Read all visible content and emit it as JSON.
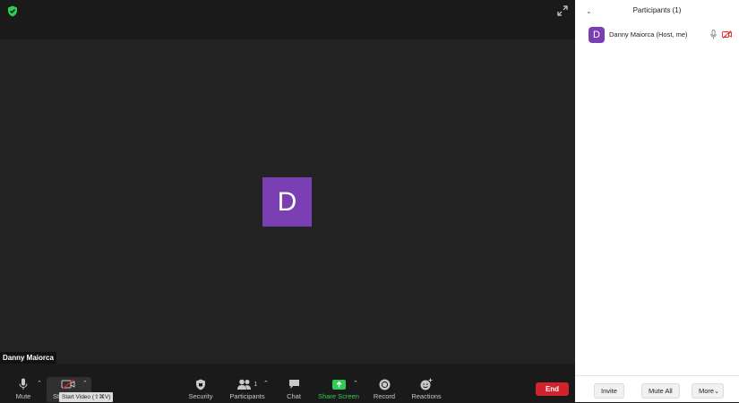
{
  "meeting": {
    "avatar_initial": "D",
    "name_tag": "Danny Maiorca"
  },
  "toolbar": {
    "mute_label": "Mute",
    "video_label": "St",
    "video_tooltip": "Start Video (⇧⌘V)",
    "security_label": "Security",
    "participants_label": "Participants",
    "participants_count": "1",
    "chat_label": "Chat",
    "share_label": "Share Screen",
    "record_label": "Record",
    "reactions_label": "Reactions",
    "end_label": "End"
  },
  "panel": {
    "title": "Participants (1)",
    "participant": {
      "initial": "D",
      "name": "Danny Maiorca (Host, me)"
    },
    "invite_label": "Invite",
    "mute_all_label": "Mute All",
    "more_label": "More"
  },
  "colors": {
    "avatar": "#7a3fb3",
    "end": "#d2222d",
    "share_green": "#2ecc55",
    "shield_green": "#2ecc55",
    "cam_off_red": "#e02424"
  }
}
